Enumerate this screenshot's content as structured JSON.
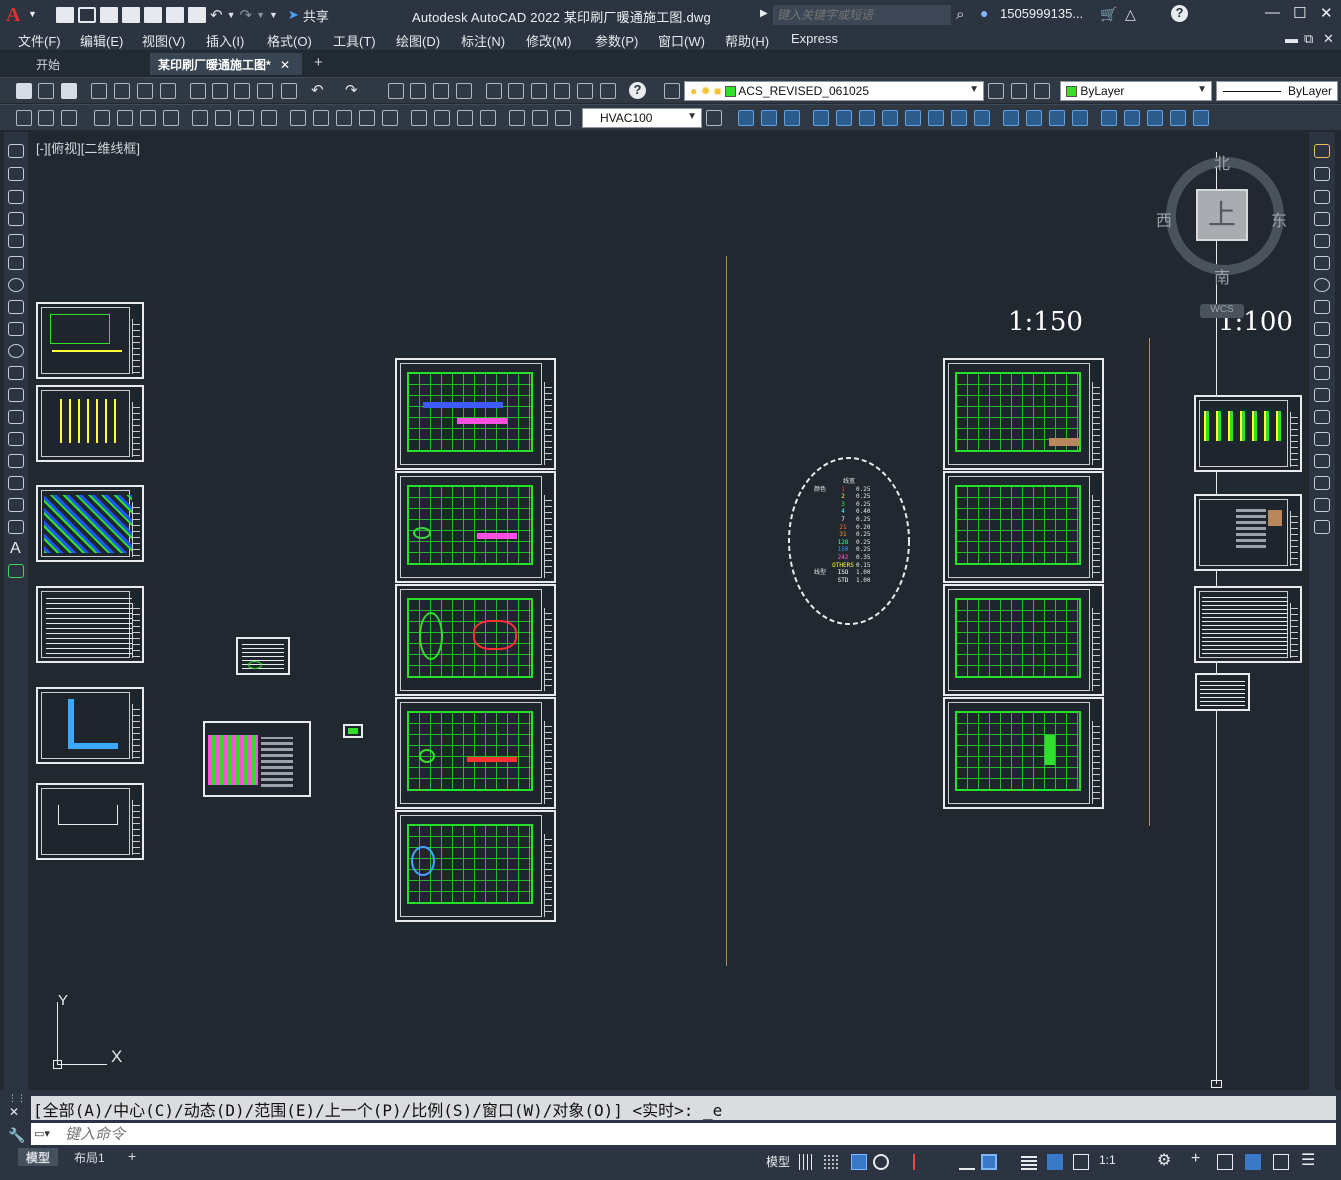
{
  "app": {
    "logo": "A",
    "title": "Autodesk AutoCAD 2022    某印刷厂暖通施工图.dwg",
    "share_label": "共享",
    "search_placeholder": "键入关键字或短语",
    "user_name": "1505999135...",
    "help_icon": "?"
  },
  "menu": [
    "文件(F)",
    "编辑(E)",
    "视图(V)",
    "插入(I)",
    "格式(O)",
    "工具(T)",
    "绘图(D)",
    "标注(N)",
    "修改(M)",
    "参数(P)",
    "窗口(W)",
    "帮助(H)",
    "Express"
  ],
  "tabs": {
    "start": "开始",
    "active": "某印刷厂暖通施工图*",
    "close": "✕",
    "add": "+"
  },
  "toolbar": {
    "layer_name": "ACS_REVISED_061025",
    "color": "ByLayer",
    "linetype": "ByLayer",
    "dimstyle": "HVAC100"
  },
  "viewport": {
    "label": "[-][俯视][二维线框]",
    "scale_150": "1:150",
    "scale_100": "1:100",
    "compass": {
      "north": "北",
      "south": "南",
      "east": "东",
      "west": "西",
      "top": "上",
      "wcs": "WCS"
    },
    "ucs": {
      "y": "Y",
      "x": "X"
    }
  },
  "plot_style_table": {
    "header": "线宽",
    "rows": [
      {
        "label": "颜色",
        "pen": "1",
        "width": "0.25",
        "color": "#ff3030"
      },
      {
        "label": "",
        "pen": "2",
        "width": "0.25",
        "color": "#ffff33"
      },
      {
        "label": "",
        "pen": "3",
        "width": "0.25",
        "color": "#33ff33"
      },
      {
        "label": "",
        "pen": "4",
        "width": "0.40",
        "color": "#33ffff"
      },
      {
        "label": "",
        "pen": "7",
        "width": "0.25",
        "color": "#ffffff"
      },
      {
        "label": "",
        "pen": "21",
        "width": "0.20",
        "color": "#ff6a3a"
      },
      {
        "label": "",
        "pen": "31",
        "width": "0.25",
        "color": "#ff9a3a"
      },
      {
        "label": "",
        "pen": "128",
        "width": "0.25",
        "color": "#33ff99"
      },
      {
        "label": "",
        "pen": "150",
        "width": "0.25",
        "color": "#3399ff"
      },
      {
        "label": "",
        "pen": "242",
        "width": "0.35",
        "color": "#ff66cc"
      },
      {
        "label": "",
        "pen": "OTHERS",
        "width": "0.15",
        "color": "#ffff33"
      },
      {
        "label": "线型",
        "pen": "ISO",
        "width": "1.00",
        "color": "#ffffff"
      },
      {
        "label": "",
        "pen": "STD",
        "width": "1.00",
        "color": "#ffffff"
      }
    ]
  },
  "command": {
    "history": "[全部(A)/中心(C)/动态(D)/范围(E)/上一个(P)/比例(S)/窗口(W)/对象(O)] <实时>: _e",
    "placeholder": "键入命令"
  },
  "status": {
    "model_tab": "模型",
    "layout_tab": "布局1",
    "add": "+",
    "model_label": "模型",
    "scale": "1:1"
  }
}
